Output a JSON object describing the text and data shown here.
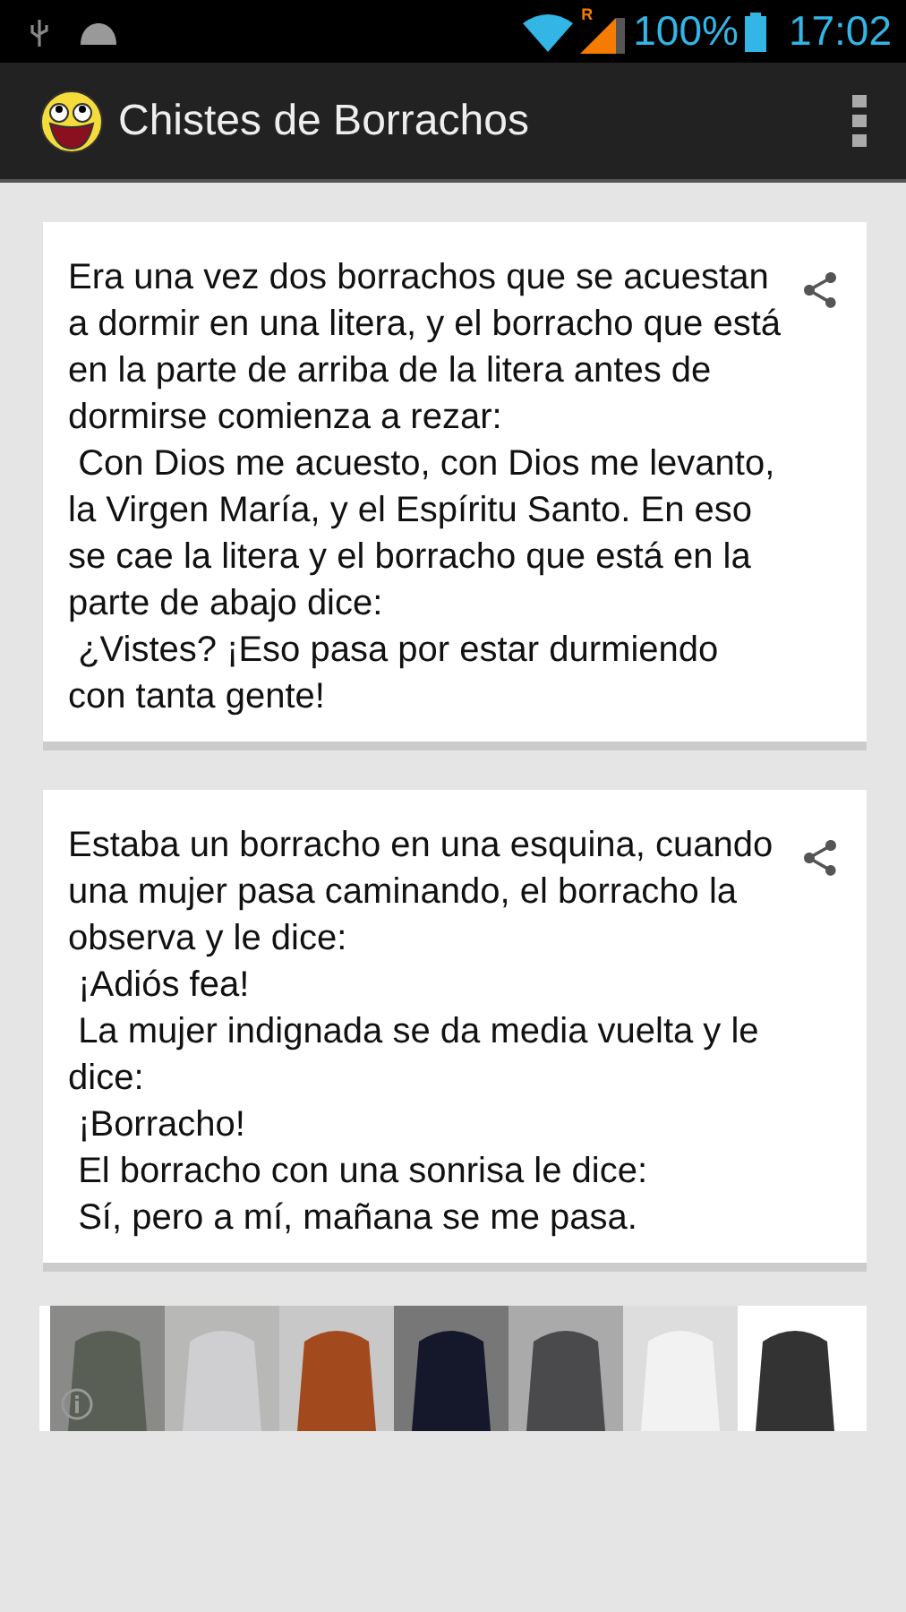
{
  "status_bar": {
    "roaming": "R",
    "battery": "100%",
    "time": "17:02"
  },
  "app_bar": {
    "title": "Chistes de Borrachos"
  },
  "jokes": [
    {
      "text": "Era una vez dos borrachos que se acuestan a dormir en una litera, y el borracho que está en la parte de arriba de la litera antes de dormirse comienza a rezar:\n Con Dios me acuesto, con Dios me levanto, la Virgen María, y el Espíritu Santo. En eso se cae la litera y el borracho que está en la parte de abajo dice:\n ¿Vistes? ¡Eso pasa por estar durmiendo con tanta gente!"
    },
    {
      "text": "Estaba un borracho en una esquina, cuando una mujer pasa caminando, el borracho la observa y le dice:\n ¡Adiós fea!\n La mujer indignada se da media vuelta y le dice:\n ¡Borracho!\n El borracho con una sonrisa le dice:\n Sí, pero a mí, mañana se me pasa."
    }
  ]
}
